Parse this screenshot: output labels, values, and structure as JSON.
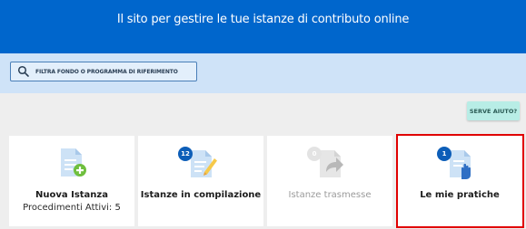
{
  "banner": {
    "text": "Il sito per gestire le tue istanze di contributo online"
  },
  "filter": {
    "label": "FILTRA FONDO O PROGRAMMA DI RIFERIMENTO",
    "icon": "search-icon"
  },
  "help": {
    "label": "SERVE AIUTO?"
  },
  "cards": [
    {
      "title": "Nuova Istanza",
      "subtitle": "Procedimenti Attivi: 5",
      "icon": "new-document-plus-icon"
    },
    {
      "title": "Istanze in compilazione",
      "badge": "12",
      "icon": "document-pencil-icon"
    },
    {
      "title": "Istanze trasmesse",
      "badge": "0",
      "icon": "document-forward-icon",
      "disabled": true
    },
    {
      "title": "Le mie pratiche",
      "badge": "1",
      "icon": "document-hand-icon",
      "highlighted": true
    }
  ],
  "colors": {
    "banner": "#0066cc",
    "filter_band": "#cfe3f8",
    "help_button": "#b8ede6",
    "badge": "#0d5eb8",
    "highlight": "#e00000"
  }
}
